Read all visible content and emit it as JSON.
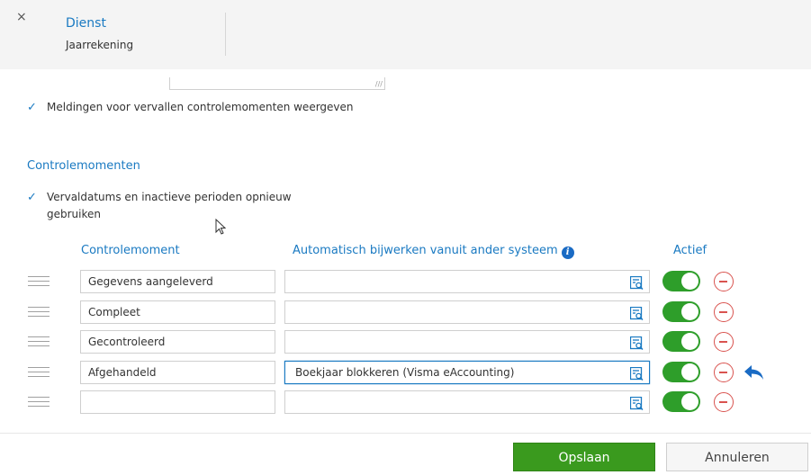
{
  "header": {
    "close_glyph": "×",
    "title": "Dienst",
    "subtitle": "Jaarrekening"
  },
  "options": {
    "notify_label": "Meldingen voor vervallen controlemomenten weergeven",
    "notify_checked": true
  },
  "section": {
    "title": "Controlemomenten",
    "reuse_label_line1": "Vervaldatums en inactieve perioden opnieuw",
    "reuse_label_line2": "gebruiken",
    "reuse_checked": true
  },
  "columns": {
    "name": "Controlemoment",
    "auto": "Automatisch bijwerken vanuit ander systeem",
    "active": "Actief"
  },
  "rows": [
    {
      "name": "Gegevens aangeleverd",
      "auto": "",
      "active": true
    },
    {
      "name": "Compleet",
      "auto": "",
      "active": true
    },
    {
      "name": "Gecontroleerd",
      "auto": "",
      "active": true
    },
    {
      "name": "Afgehandeld",
      "auto": "Boekjaar blokkeren (Visma eAccounting)",
      "active": true,
      "focused": true,
      "undo": true
    },
    {
      "name": "",
      "auto": "",
      "active": true
    }
  ],
  "footer": {
    "save_label": "Opslaan",
    "cancel_label": "Annuleren"
  },
  "colors": {
    "accent": "#1a7ac2",
    "toggle_on": "#2e9e2a",
    "remove": "#d9534f",
    "save_btn": "#3a9a1e"
  }
}
